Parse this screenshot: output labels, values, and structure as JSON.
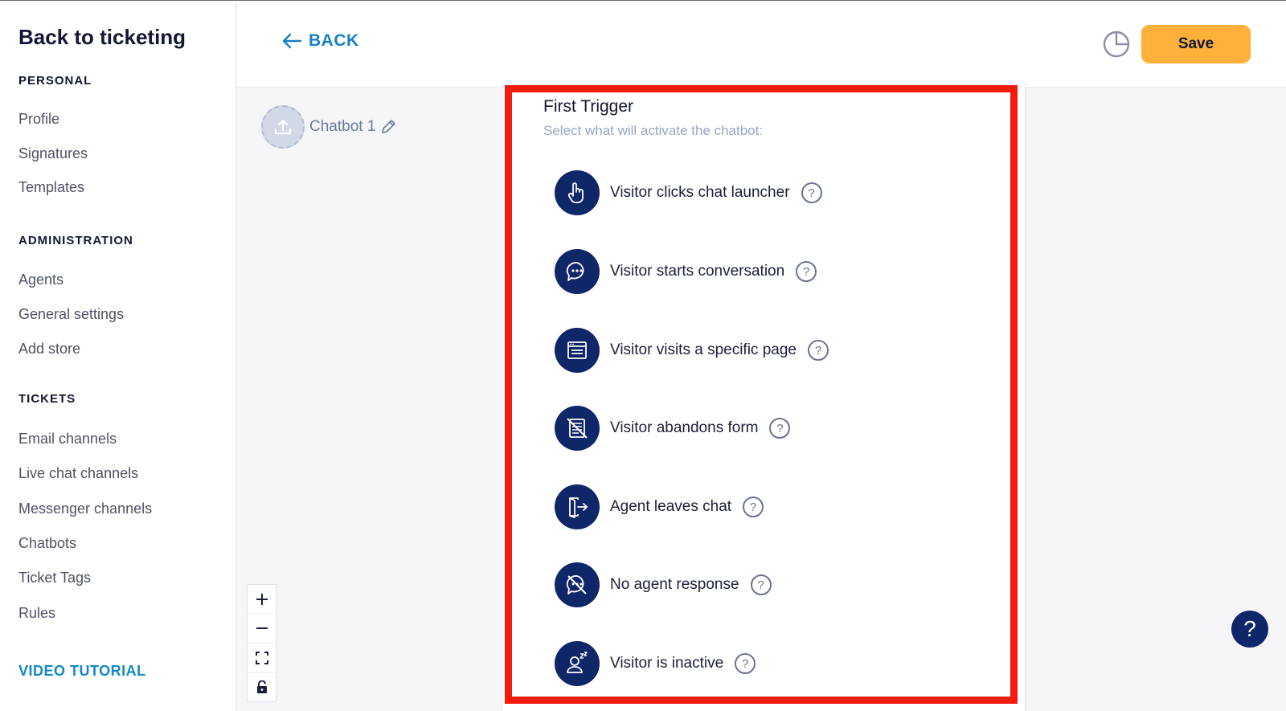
{
  "sidebar": {
    "title": "Back to ticketing",
    "sections": [
      {
        "label": "PERSONAL",
        "items": [
          "Profile",
          "Signatures",
          "Templates"
        ]
      },
      {
        "label": "ADMINISTRATION",
        "items": [
          "Agents",
          "General settings",
          "Add store"
        ]
      },
      {
        "label": "TICKETS",
        "items": [
          "Email channels",
          "Live chat channels",
          "Messenger channels",
          "Chatbots",
          "Ticket Tags",
          "Rules"
        ]
      }
    ],
    "video_tutorial": "VIDEO TUTORIAL"
  },
  "header": {
    "back_label": "BACK",
    "save_label": "Save"
  },
  "canvas": {
    "node_name": "Chatbot 1",
    "zoom_controls": [
      "+",
      "−",
      "fit-screen",
      "lock"
    ]
  },
  "panel": {
    "title": "First Trigger",
    "subtitle": "Select what will activate the chatbot:",
    "triggers": [
      {
        "label": "Visitor clicks chat launcher",
        "icon": "pointing-hand-icon"
      },
      {
        "label": "Visitor starts conversation",
        "icon": "chat-bubble-icon"
      },
      {
        "label": "Visitor visits a specific page",
        "icon": "browser-page-icon"
      },
      {
        "label": "Visitor abandons form",
        "icon": "form-crossed-icon"
      },
      {
        "label": "Agent leaves chat",
        "icon": "exit-door-icon"
      },
      {
        "label": "No agent response",
        "icon": "chat-crossed-icon"
      },
      {
        "label": "Visitor is inactive",
        "icon": "sleeping-user-icon"
      }
    ],
    "help_mark": "?"
  },
  "help_button": "?",
  "colors": {
    "accent_blue": "#1780c6",
    "save_orange": "#fdb13b",
    "icon_navy": "#0f2668",
    "highlight_red": "#f31c0c"
  }
}
